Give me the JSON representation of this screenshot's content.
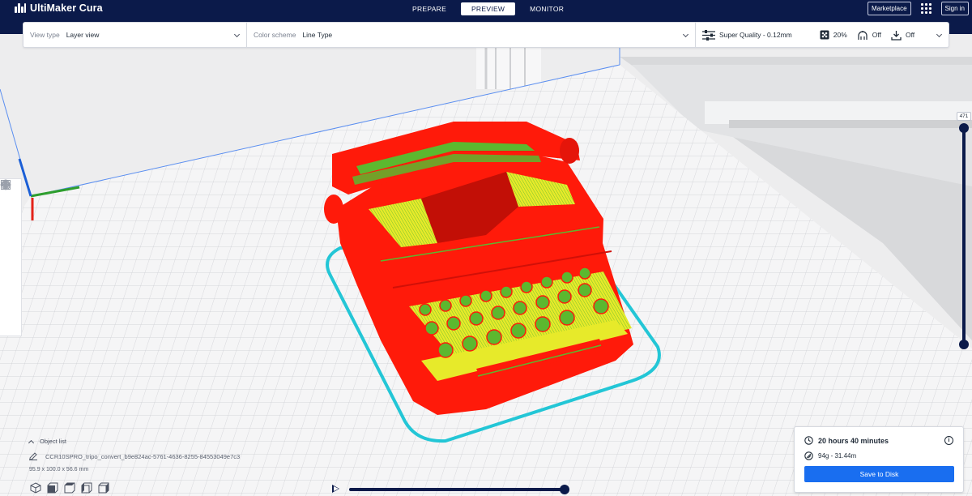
{
  "app": {
    "title": "UltiMaker Cura"
  },
  "stages": [
    {
      "label": "PREPARE",
      "active": false
    },
    {
      "label": "PREVIEW",
      "active": true
    },
    {
      "label": "MONITOR",
      "active": false
    }
  ],
  "topbar": {
    "marketplace": "Marketplace",
    "sign_in": "Sign in"
  },
  "settings": {
    "view_type_label": "View type",
    "view_type_value": "Layer view",
    "color_scheme_label": "Color scheme",
    "color_scheme_value": "Line Type",
    "quality": "Super Quality - 0.12mm",
    "infill": "20%",
    "support": "Off",
    "adhesion": "Off"
  },
  "layer_slider": {
    "current_layer": "471",
    "level": 1.0
  },
  "path_slider": {
    "level": 1.0
  },
  "object_list": {
    "header": "Object list",
    "file": "CCR10SPRO_tripo_convert_b9e824ac-5761-4636-8255-84553049e7c3",
    "dimensions": "95.9 x 100.0 x 56.6 mm"
  },
  "print_info": {
    "time": "20 hours 40 minutes",
    "material": "94g - 31.44m",
    "save_label": "Save to Disk"
  },
  "colors": {
    "topbar": "#0b1a4a",
    "accent_blue": "#196ef0",
    "model_red": "#ff1a0a",
    "model_yellow": "#e7ea2a",
    "model_green": "#5cb82f",
    "skirt_cyan": "#23c6d6"
  }
}
